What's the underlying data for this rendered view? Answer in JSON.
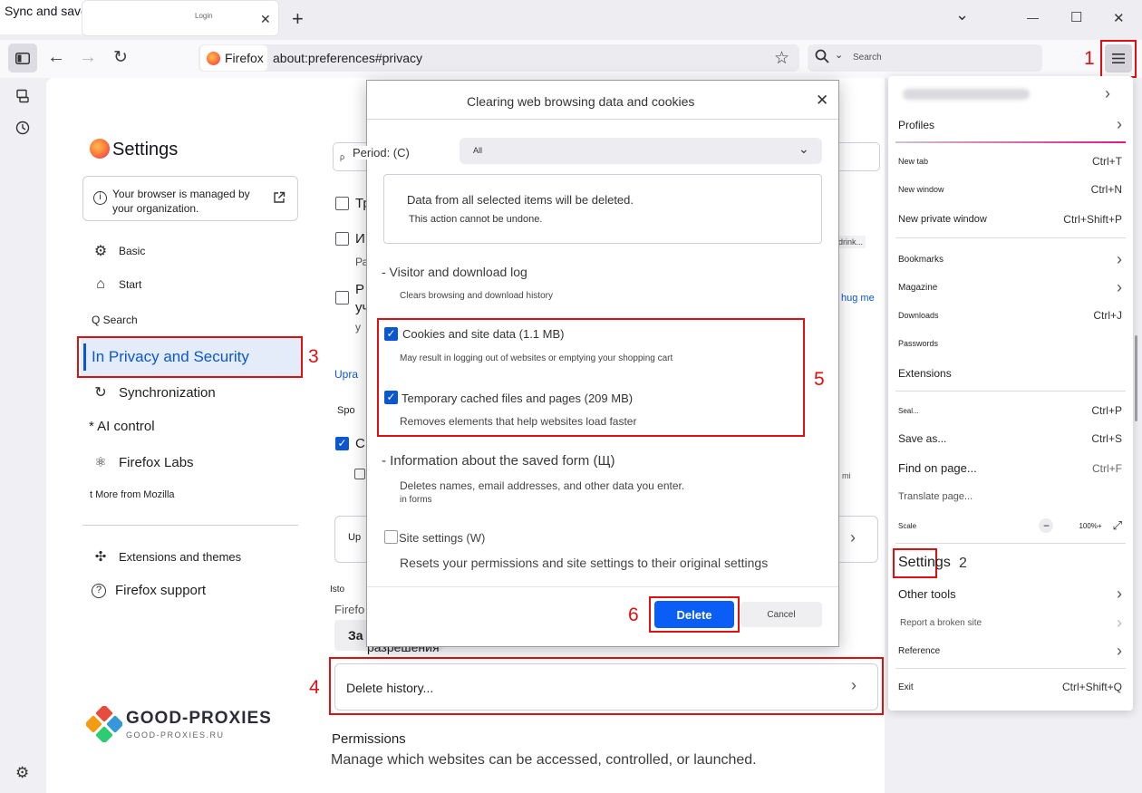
{
  "window": {
    "tab_title": "Sync and save data",
    "tab2_title": "Login",
    "new_tab": "+",
    "ctrl_chevron": "⌄",
    "ctrl_min": "—",
    "ctrl_max": "☐",
    "ctrl_close": "✕"
  },
  "navbar": {
    "identity_label": "Firefox",
    "url": "about:preferences#privacy",
    "search_placeholder": "Search"
  },
  "settings": {
    "title": "Settings",
    "managed_notice": "Your browser is managed by your organization.",
    "nav": {
      "basic": "Basic",
      "start": "Start",
      "search": "Q Search",
      "privacy": "In Privacy and Security",
      "sync": "Synchronization",
      "ai": "* AI control",
      "labs": "Firefox Labs",
      "more": "t More from Mozilla",
      "extensions": "Extensions and themes",
      "support": "Firefox support"
    },
    "bg_fragments": {
      "f1": "Тр",
      "f2": "И",
      "f3": "Ра",
      "f4": "Р",
      "f5": "уч",
      "f6": "у",
      "f7": "Upra",
      "f8": "Spo",
      "f9": "С",
      "f10": "Up",
      "f11": "Isto",
      "f12": "Firefo",
      "f13": "За",
      "f14": "разрешения",
      "f15": "drink...",
      "f16": "hug me",
      "f17": "mi",
      "f18": "ρ"
    },
    "delete_history": "Delete history...",
    "permissions_title": "Permissions",
    "permissions_desc": "Manage which websites can be accessed, controlled, or launched."
  },
  "dialog": {
    "title": "Clearing web browsing data and cookies",
    "period_label": "Period: (C)",
    "period_value": "All",
    "warning_line1": "Data from all selected items will be deleted.",
    "warning_line2": "This action cannot be undone.",
    "visitor_head": "- Visitor and download log",
    "visitor_desc": "Clears browsing and download history",
    "cookies_label": "Cookies and site data (1.1 MB)",
    "cookies_desc": "May result in logging out of websites or emptying your shopping cart",
    "cache_label": "Temporary cached files and pages (209 MB)",
    "cache_desc": "Removes elements that help websites load faster",
    "form_head": "- Information about the saved form (Щ)",
    "form_desc1": "Deletes names, email addresses, and other data you enter.",
    "form_desc2": "in forms",
    "site_label": "Site settings (W)",
    "site_desc": "Resets your permissions and site settings to their original settings",
    "delete_btn": "Delete",
    "cancel_btn": "Cancel"
  },
  "appmenu": {
    "profiles": "Profiles",
    "new_tab": "New tab",
    "new_tab_sc": "Ctrl+T",
    "new_window": "New window",
    "new_window_sc": "Ctrl+N",
    "new_private": "New private window",
    "new_private_sc": "Ctrl+Shift+P",
    "bookmarks": "Bookmarks",
    "magazine": "Magazine",
    "downloads": "Downloads",
    "downloads_sc": "Ctrl+J",
    "passwords": "Passwords",
    "extensions": "Extensions",
    "seal": "Seal...",
    "seal_sc": "Ctrl+P",
    "save_as": "Save as...",
    "save_as_sc": "Ctrl+S",
    "find": "Find on page...",
    "find_sc": "Ctrl+F",
    "translate": "Translate page...",
    "scale": "Scale",
    "zoom_minus": "−",
    "zoom_level": "100%+",
    "settings": "Settings",
    "other_tools": "Other tools",
    "report": "Report a broken site",
    "reference": "Reference",
    "exit": "Exit",
    "exit_sc": "Ctrl+Shift+Q"
  },
  "annotations": {
    "n1": "1",
    "n2": "2",
    "n3": "3",
    "n4": "4",
    "n5": "5",
    "n6": "6"
  },
  "watermark": {
    "brand": "GOOD-PROXIES",
    "domain": "GOOD-PROXIES.RU"
  },
  "colors": {
    "annotation_red": "#dd1111",
    "primary_blue": "#0b5ef5",
    "accent_blue": "#0b57d0"
  }
}
